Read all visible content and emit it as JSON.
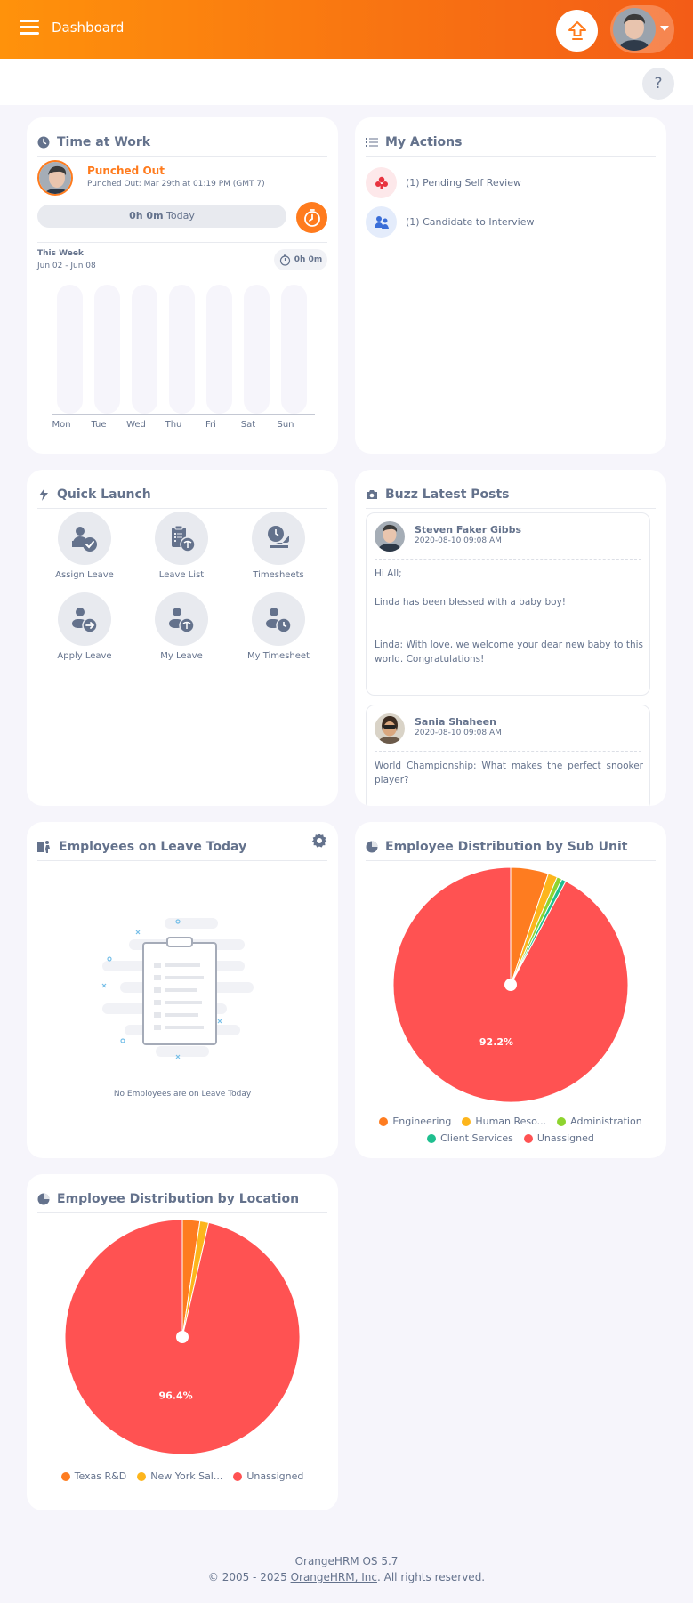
{
  "header": {
    "title": "Dashboard",
    "help_label": "?"
  },
  "colors": {
    "brand_orange": "#ff7b1d",
    "gradient_start": "#ff920b",
    "gradient_end": "#f35c17"
  },
  "time_at_work": {
    "title": "Time at Work",
    "status": "Punched Out",
    "detail": "Punched Out: Mar 29th at 01:19 PM (GMT 7)",
    "today_hours": "0h 0m",
    "today_label": "Today",
    "week_label": "This Week",
    "week_range": "Jun 02 - Jun 08",
    "week_total": "0h 0m",
    "days": [
      "Mon",
      "Tue",
      "Wed",
      "Thu",
      "Fri",
      "Sat",
      "Sun"
    ]
  },
  "my_actions": {
    "title": "My Actions",
    "items": [
      {
        "label": "(1) Pending Self Review",
        "icon": "self-review-icon"
      },
      {
        "label": "(1) Candidate to Interview",
        "icon": "interview-icon"
      }
    ]
  },
  "quick_launch": {
    "title": "Quick Launch",
    "items": [
      {
        "label": "Assign Leave",
        "icon": "assign-leave-icon"
      },
      {
        "label": "Leave List",
        "icon": "leave-list-icon"
      },
      {
        "label": "Timesheets",
        "icon": "timesheets-icon"
      },
      {
        "label": "Apply Leave",
        "icon": "apply-leave-icon"
      },
      {
        "label": "My Leave",
        "icon": "my-leave-icon"
      },
      {
        "label": "My Timesheet",
        "icon": "my-timesheet-icon"
      }
    ]
  },
  "buzz": {
    "title": "Buzz Latest Posts",
    "posts": [
      {
        "name": "Steven Faker Gibbs",
        "date": "2020-08-10 09:08 AM",
        "body": "Hi All;\n\nLinda has been blessed with a baby boy!\n\n\nLinda: With love, we welcome your dear new baby to this world. Congratulations!"
      },
      {
        "name": "Sania Shaheen",
        "date": "2020-08-10 09:08 AM",
        "body": "World Championship: What makes the perfect snooker player?"
      }
    ]
  },
  "leave_today": {
    "title": "Employees on Leave Today",
    "empty_text": "No Employees are on Leave Today"
  },
  "chart_data": [
    {
      "type": "pie",
      "title": "Employee Distribution by Sub Unit",
      "categories": [
        "Engineering",
        "Human Reso...",
        "Administration",
        "Client Services",
        "Unassigned"
      ],
      "values": [
        5.2,
        1.3,
        0.7,
        0.6,
        92.2
      ],
      "colors": [
        "#fe7c20",
        "#fdb51c",
        "#8ed42f",
        "#1fbf8f",
        "#ff5252"
      ],
      "data_labels": [
        "",
        "",
        "",
        "",
        "92.2%"
      ],
      "legend": "bottom"
    },
    {
      "type": "pie",
      "title": "Employee Distribution by Location",
      "categories": [
        "Texas R&D",
        "New York Sal...",
        "Unassigned"
      ],
      "values": [
        2.4,
        1.2,
        96.4
      ],
      "colors": [
        "#fe7c20",
        "#fdb51c",
        "#ff5252"
      ],
      "data_labels": [
        "",
        "",
        "96.4%"
      ],
      "legend": "bottom"
    }
  ],
  "footer": {
    "version": "OrangeHRM OS 5.7",
    "copyright_prefix": "© 2005 - 2025",
    "company_link": "OrangeHRM, Inc",
    "copyright_suffix": ". All rights reserved."
  }
}
